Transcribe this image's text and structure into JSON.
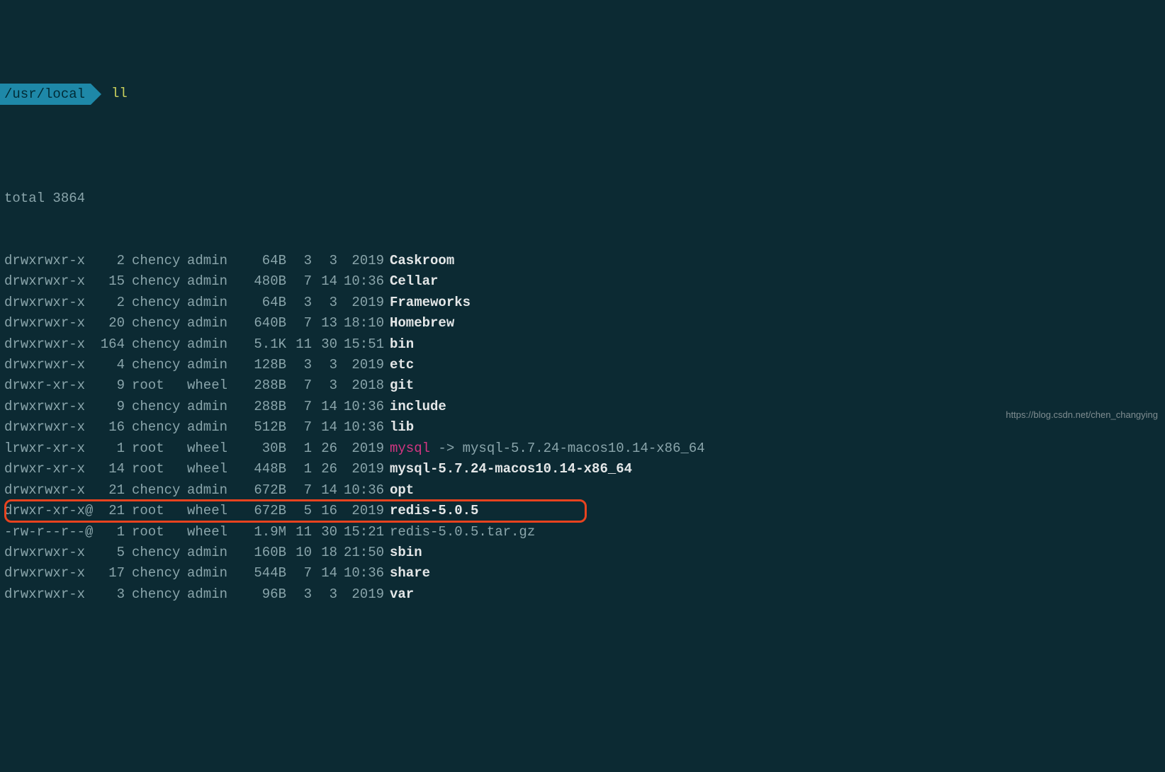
{
  "prompt": {
    "path": "/usr/local",
    "command": "ll"
  },
  "total_line": "total 3864",
  "rows": [
    {
      "perms": "drwxrwxr-x",
      "links": "2",
      "owner": "chency",
      "group": "admin",
      "size": "64B",
      "d1": "3",
      "d2": "3",
      "d3": "2019",
      "name": "Caskroom",
      "style": "bold"
    },
    {
      "perms": "drwxrwxr-x",
      "links": "15",
      "owner": "chency",
      "group": "admin",
      "size": "480B",
      "d1": "7",
      "d2": "14",
      "d3": "10:36",
      "name": "Cellar",
      "style": "bold"
    },
    {
      "perms": "drwxrwxr-x",
      "links": "2",
      "owner": "chency",
      "group": "admin",
      "size": "64B",
      "d1": "3",
      "d2": "3",
      "d3": "2019",
      "name": "Frameworks",
      "style": "bold"
    },
    {
      "perms": "drwxrwxr-x",
      "links": "20",
      "owner": "chency",
      "group": "admin",
      "size": "640B",
      "d1": "7",
      "d2": "13",
      "d3": "18:10",
      "name": "Homebrew",
      "style": "bold"
    },
    {
      "perms": "drwxrwxr-x",
      "links": "164",
      "owner": "chency",
      "group": "admin",
      "size": "5.1K",
      "d1": "11",
      "d2": "30",
      "d3": "15:51",
      "name": "bin",
      "style": "bold"
    },
    {
      "perms": "drwxrwxr-x",
      "links": "4",
      "owner": "chency",
      "group": "admin",
      "size": "128B",
      "d1": "3",
      "d2": "3",
      "d3": "2019",
      "name": "etc",
      "style": "bold"
    },
    {
      "perms": "drwxr-xr-x",
      "links": "9",
      "owner": "root",
      "group": "wheel",
      "size": "288B",
      "d1": "7",
      "d2": "3",
      "d3": "2018",
      "name": "git",
      "style": "bold"
    },
    {
      "perms": "drwxrwxr-x",
      "links": "9",
      "owner": "chency",
      "group": "admin",
      "size": "288B",
      "d1": "7",
      "d2": "14",
      "d3": "10:36",
      "name": "include",
      "style": "bold"
    },
    {
      "perms": "drwxrwxr-x",
      "links": "16",
      "owner": "chency",
      "group": "admin",
      "size": "512B",
      "d1": "7",
      "d2": "14",
      "d3": "10:36",
      "name": "lib",
      "style": "bold"
    },
    {
      "perms": "lrwxr-xr-x",
      "links": "1",
      "owner": "root",
      "group": "wheel",
      "size": "30B",
      "d1": "1",
      "d2": "26",
      "d3": "2019",
      "name": "mysql",
      "style": "symlink",
      "target": " -> mysql-5.7.24-macos10.14-x86_64"
    },
    {
      "perms": "drwxr-xr-x",
      "links": "14",
      "owner": "root",
      "group": "wheel",
      "size": "448B",
      "d1": "1",
      "d2": "26",
      "d3": "2019",
      "name": "mysql-5.7.24-macos10.14-x86_64",
      "style": "bold"
    },
    {
      "perms": "drwxrwxr-x",
      "links": "21",
      "owner": "chency",
      "group": "admin",
      "size": "672B",
      "d1": "7",
      "d2": "14",
      "d3": "10:36",
      "name": "opt",
      "style": "bold"
    },
    {
      "perms": "drwxr-xr-x@",
      "links": "21",
      "owner": "root",
      "group": "wheel",
      "size": "672B",
      "d1": "5",
      "d2": "16",
      "d3": "2019",
      "name": "redis-5.0.5",
      "style": "bold",
      "highlighted": true
    },
    {
      "perms": "-rw-r--r--@",
      "links": "1",
      "owner": "root",
      "group": "wheel",
      "size": "1.9M",
      "d1": "11",
      "d2": "30",
      "d3": "15:21",
      "name": "redis-5.0.5.tar.gz",
      "style": "file"
    },
    {
      "perms": "drwxrwxr-x",
      "links": "5",
      "owner": "chency",
      "group": "admin",
      "size": "160B",
      "d1": "10",
      "d2": "18",
      "d3": "21:50",
      "name": "sbin",
      "style": "bold"
    },
    {
      "perms": "drwxrwxr-x",
      "links": "17",
      "owner": "chency",
      "group": "admin",
      "size": "544B",
      "d1": "7",
      "d2": "14",
      "d3": "10:36",
      "name": "share",
      "style": "bold"
    },
    {
      "perms": "drwxrwxr-x",
      "links": "3",
      "owner": "chency",
      "group": "admin",
      "size": "96B",
      "d1": "3",
      "d2": "3",
      "d3": "2019",
      "name": "var",
      "style": "bold"
    }
  ],
  "watermark": "https://blog.csdn.net/chen_changying"
}
